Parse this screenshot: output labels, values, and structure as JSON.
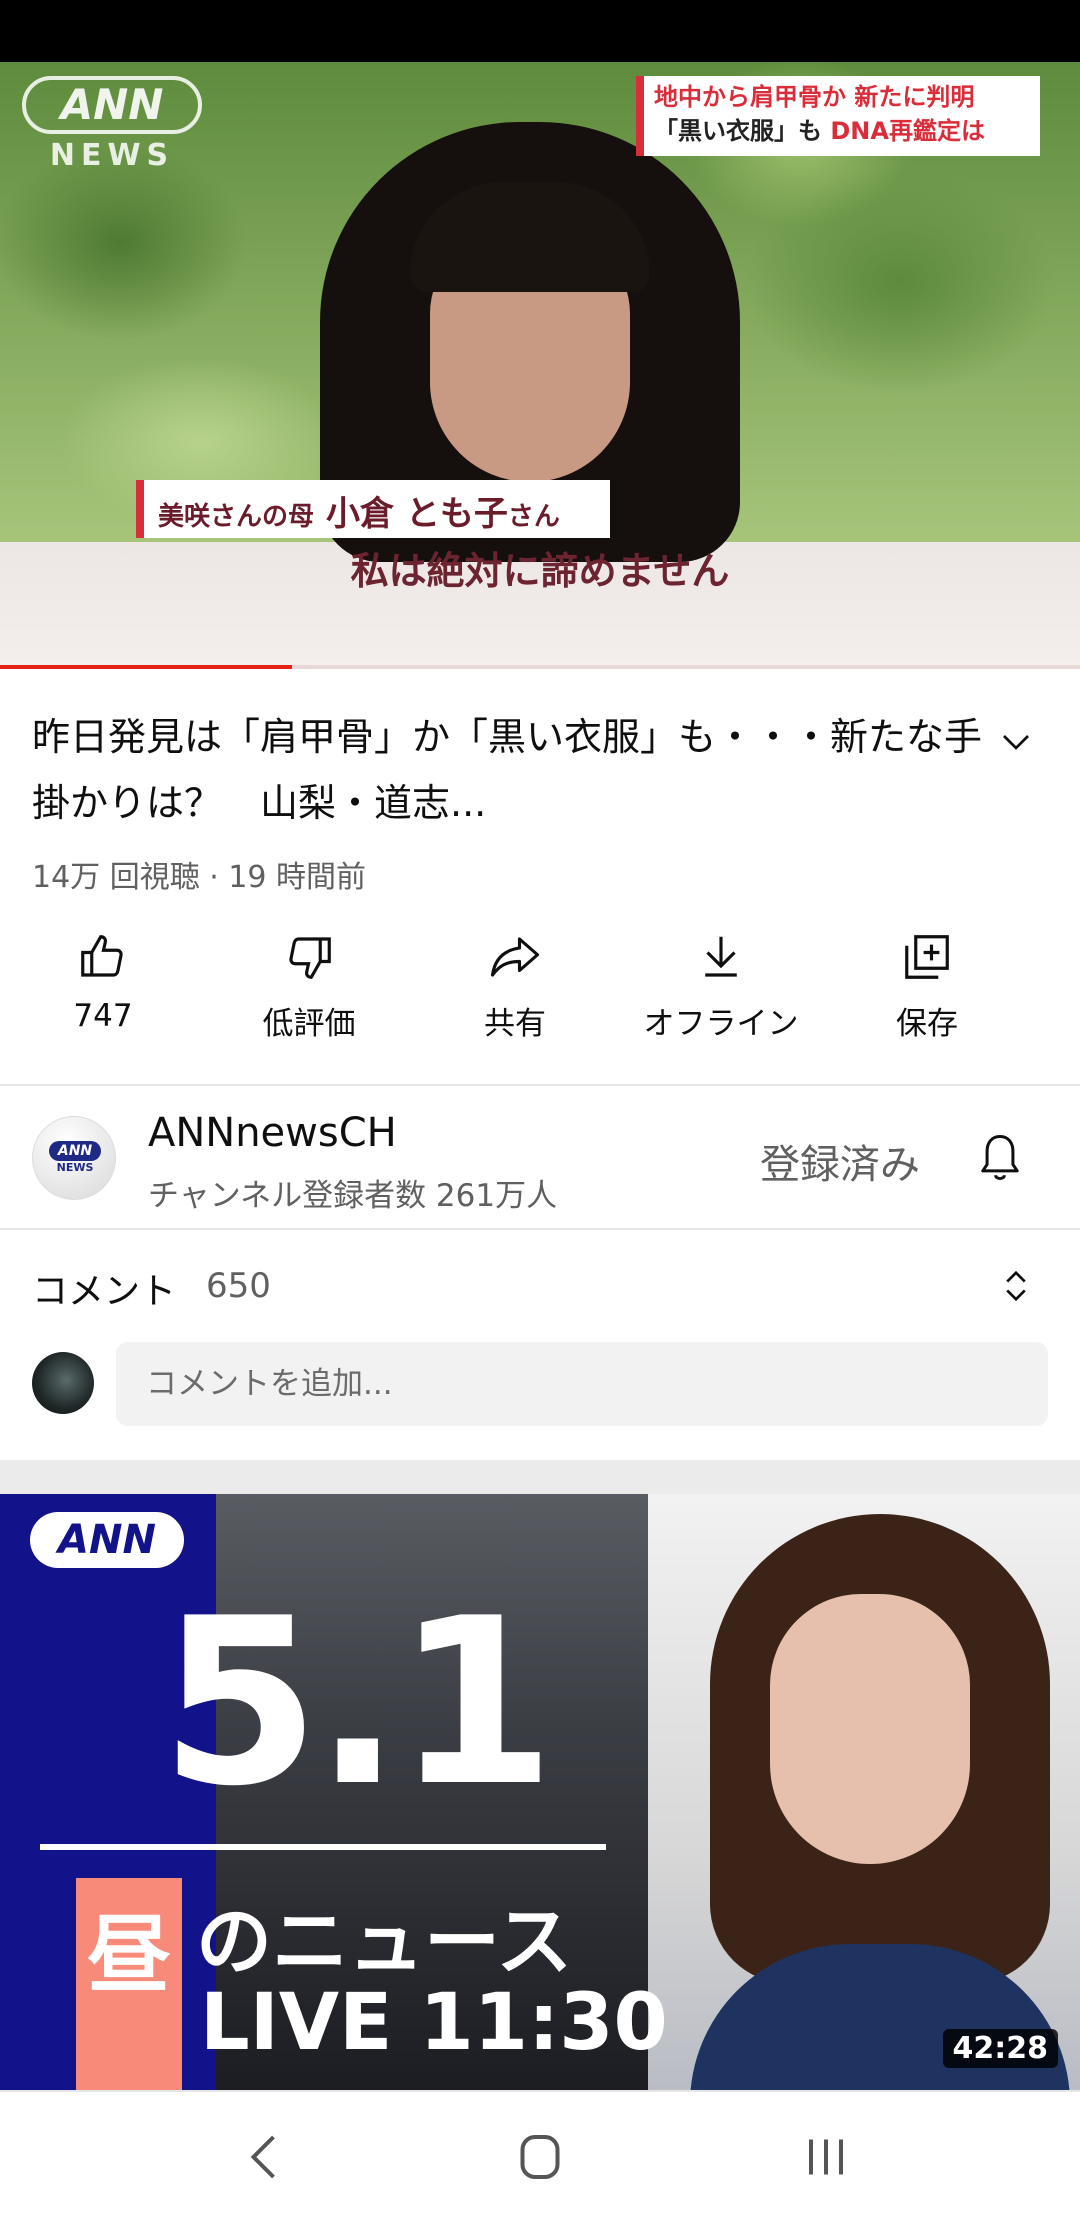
{
  "player": {
    "channel_logo": "ANN",
    "channel_logo_sub": "NEWS",
    "headline_line1": "地中から肩甲骨か 新たに判明",
    "headline_line2_a": "「黒い衣服」も",
    "headline_line2_b": "DNA再鑑定は",
    "name_small": "美咲さんの母",
    "name_big": "小倉 とも子",
    "name_suffix": "さん",
    "caption": "私は絶対に諦めません",
    "progress_fraction": 0.27
  },
  "video": {
    "title": "昨日発見は「肩甲骨」か「黒い衣服」も・・・新たな手掛かりは？　山梨・道志...",
    "meta": "14万 回視聴 · 19 時間前"
  },
  "actions": [
    {
      "label": "747",
      "icon": "thumbs-up-icon"
    },
    {
      "label": "低評価",
      "icon": "thumbs-down-icon"
    },
    {
      "label": "共有",
      "icon": "share-icon"
    },
    {
      "label": "オフライン",
      "icon": "download-icon"
    },
    {
      "label": "保存",
      "icon": "save-playlist-icon"
    }
  ],
  "channel": {
    "name": "ANNnewsCH",
    "subscribers": "チャンネル登録者数 261万人",
    "subscribe_state": "登録済み",
    "avatar_text": "ANN",
    "avatar_sub": "NEWS"
  },
  "comments": {
    "label": "コメント",
    "count": "650",
    "placeholder": "コメントを追加..."
  },
  "next_video": {
    "logo": "ANN",
    "date": "5.1",
    "hiru": "昼",
    "news_text": "のニュース",
    "live_text": "LIVE 11:30",
    "duration": "42:28"
  },
  "colors": {
    "accent_red": "#e62117",
    "ann_blue": "#12128a",
    "text_secondary": "#606060"
  }
}
